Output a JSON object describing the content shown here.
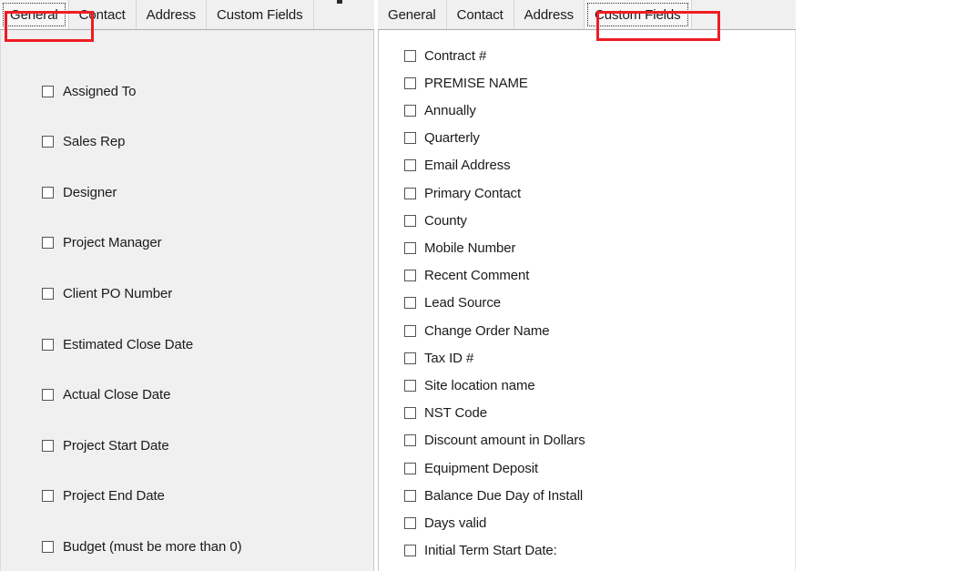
{
  "left_panel": {
    "tabs": [
      {
        "label": "General",
        "selected": true,
        "focused": true
      },
      {
        "label": "Contact",
        "selected": false,
        "focused": false
      },
      {
        "label": "Address",
        "selected": false,
        "focused": false
      },
      {
        "label": "Custom Fields",
        "selected": false,
        "focused": false
      }
    ],
    "checkboxes": [
      {
        "label": "Assigned To",
        "checked": false
      },
      {
        "label": "Sales Rep",
        "checked": false
      },
      {
        "label": "Designer",
        "checked": false
      },
      {
        "label": "Project Manager",
        "checked": false
      },
      {
        "label": "Client PO Number",
        "checked": false
      },
      {
        "label": "Estimated Close Date",
        "checked": false
      },
      {
        "label": "Actual Close Date",
        "checked": false
      },
      {
        "label": "Project Start Date",
        "checked": false
      },
      {
        "label": "Project End Date",
        "checked": false
      },
      {
        "label": "Budget (must be more than 0)",
        "checked": false
      }
    ]
  },
  "right_panel": {
    "tabs": [
      {
        "label": "General",
        "selected": false,
        "focused": false
      },
      {
        "label": "Contact",
        "selected": false,
        "focused": false
      },
      {
        "label": "Address",
        "selected": false,
        "focused": false
      },
      {
        "label": "Custom Fields",
        "selected": true,
        "focused": true
      }
    ],
    "checkboxes": [
      {
        "label": "Contract #",
        "checked": false
      },
      {
        "label": "PREMISE NAME",
        "checked": false
      },
      {
        "label": "Annually",
        "checked": false
      },
      {
        "label": "Quarterly",
        "checked": false
      },
      {
        "label": "Email Address",
        "checked": false
      },
      {
        "label": "Primary Contact",
        "checked": false
      },
      {
        "label": "County",
        "checked": false
      },
      {
        "label": "Mobile Number",
        "checked": false
      },
      {
        "label": "Recent Comment",
        "checked": false
      },
      {
        "label": "Lead Source",
        "checked": false
      },
      {
        "label": "Change Order Name",
        "checked": false
      },
      {
        "label": "Tax ID #",
        "checked": false
      },
      {
        "label": "Site location name",
        "checked": false
      },
      {
        "label": "NST Code",
        "checked": false
      },
      {
        "label": "Discount amount in Dollars",
        "checked": false
      },
      {
        "label": "Equipment Deposit",
        "checked": false
      },
      {
        "label": "Balance Due Day of Install",
        "checked": false
      },
      {
        "label": "Days valid",
        "checked": false
      },
      {
        "label": "Initial Term Start Date:",
        "checked": false
      }
    ]
  },
  "annotations": {
    "highlight_color": "#ee1d23",
    "boxes": [
      {
        "name": "highlight-general-tab",
        "target": "General"
      },
      {
        "name": "highlight-custom-fields-tab",
        "target": "Custom Fields"
      }
    ]
  }
}
